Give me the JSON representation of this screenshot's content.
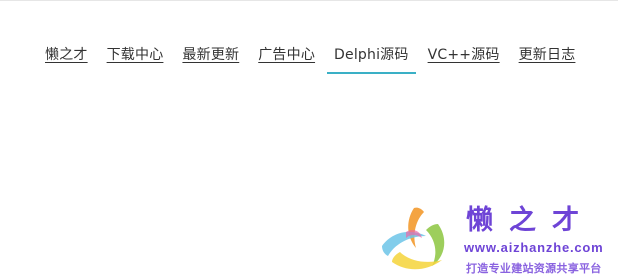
{
  "nav": {
    "items": [
      {
        "label": "懒之才",
        "active": false
      },
      {
        "label": "下载中心",
        "active": false
      },
      {
        "label": "最新更新",
        "active": false
      },
      {
        "label": "广告中心",
        "active": false
      },
      {
        "label": "Delphi源码",
        "active": true
      },
      {
        "label": "VC++源码",
        "active": false
      },
      {
        "label": "更新日志",
        "active": false
      }
    ],
    "accent_color": "#3ab0c6"
  },
  "watermark": {
    "title": "懒之才",
    "url": "www.aizhanzhe.com",
    "slogan": "打造专业建站资源共享平台",
    "logo_icon": "colorful-swirl-logo",
    "brand_color": "#6e44d6"
  }
}
